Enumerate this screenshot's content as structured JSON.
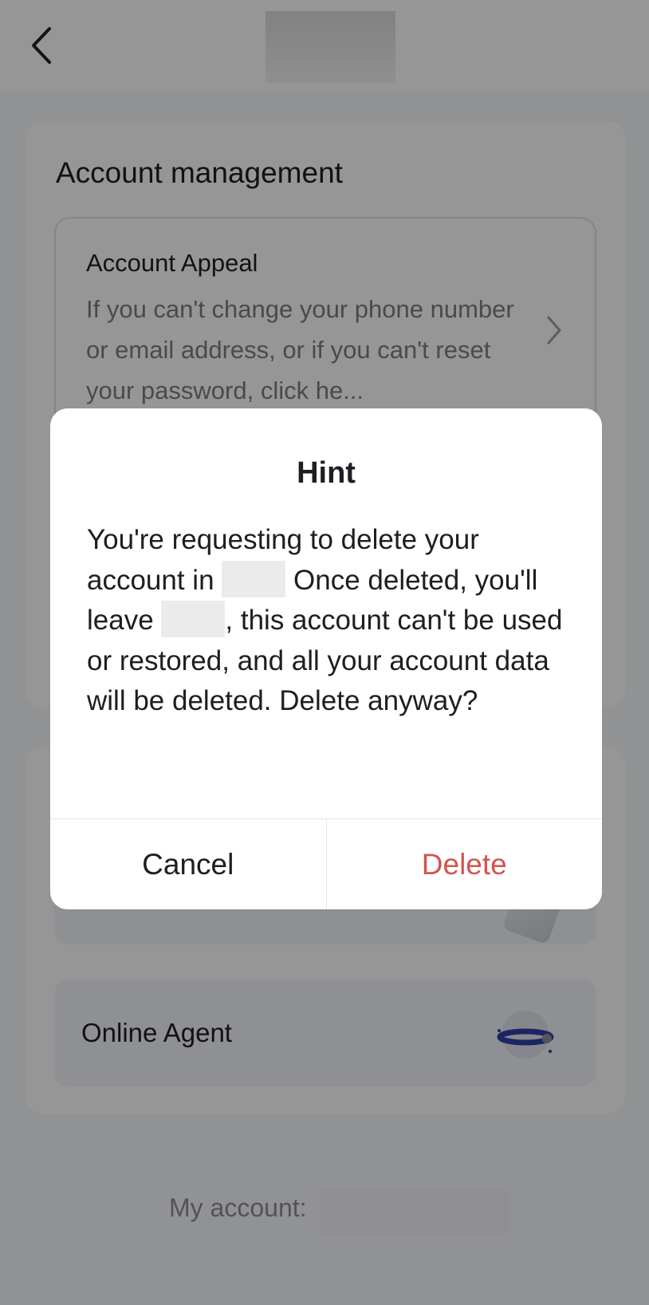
{
  "section": {
    "title": "Account management"
  },
  "appeal": {
    "title": "Account Appeal",
    "description": "If you can't change your phone number or email address, or if you can't reset your password, click he..."
  },
  "online_agent": {
    "label": "Online Agent"
  },
  "footer": {
    "my_account_label": "My account:"
  },
  "dialog": {
    "title": "Hint",
    "message_part1": "You're requesting to delete your account in",
    "message_part2": "Once deleted, you'll leave",
    "message_part3": ", this account can't be used or restored, and all your account data will be deleted. Delete anyway?",
    "cancel_label": "Cancel",
    "delete_label": "Delete"
  },
  "colors": {
    "delete": "#d2544f",
    "overlay": "rgba(0,0,0,0.40)"
  }
}
